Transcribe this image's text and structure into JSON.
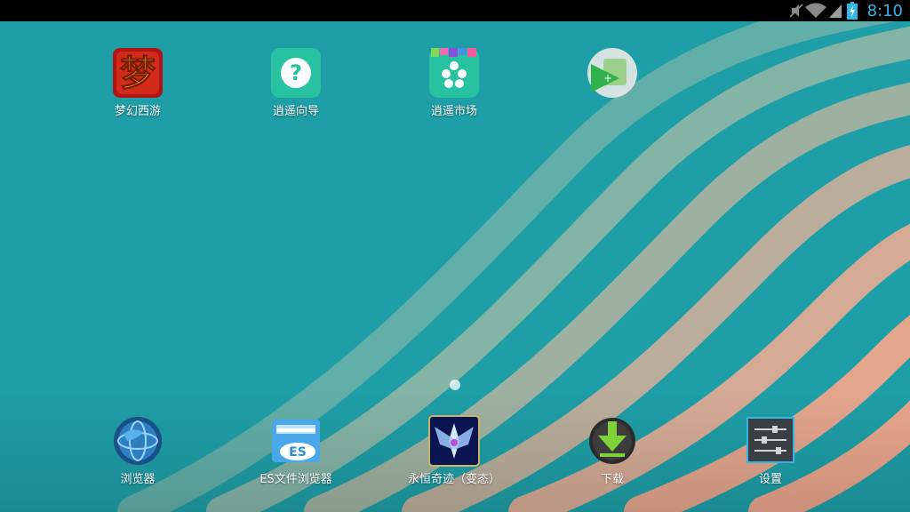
{
  "status_bar": {
    "time": "8:10",
    "icons": [
      "mute-icon",
      "wifi-icon",
      "signal-icon",
      "battery-charging-icon"
    ],
    "clock_color": "#33b5e5"
  },
  "wallpaper": {
    "base_color": "#1e9ea7",
    "stripe_colors": [
      "#8fb6a6",
      "#c3ae9b",
      "#e3a58c"
    ]
  },
  "home_apps": [
    {
      "label": "梦幻西游",
      "icon": "menghuanxiyou-game-icon"
    },
    {
      "label": "逍遥向导",
      "icon": "help-guide-icon"
    },
    {
      "label": "逍遥市场",
      "icon": "market-icon"
    },
    {
      "label": "",
      "icon": "game-center-icon"
    }
  ],
  "dock_apps": [
    {
      "label": "浏览器",
      "icon": "browser-globe-icon"
    },
    {
      "label": "ES文件浏览器",
      "icon": "es-file-explorer-icon"
    },
    {
      "label": "永恒奇迹（变态）",
      "icon": "eternal-miracle-game-icon"
    },
    {
      "label": "下载",
      "icon": "download-icon"
    },
    {
      "label": "设置",
      "icon": "settings-icon"
    }
  ]
}
